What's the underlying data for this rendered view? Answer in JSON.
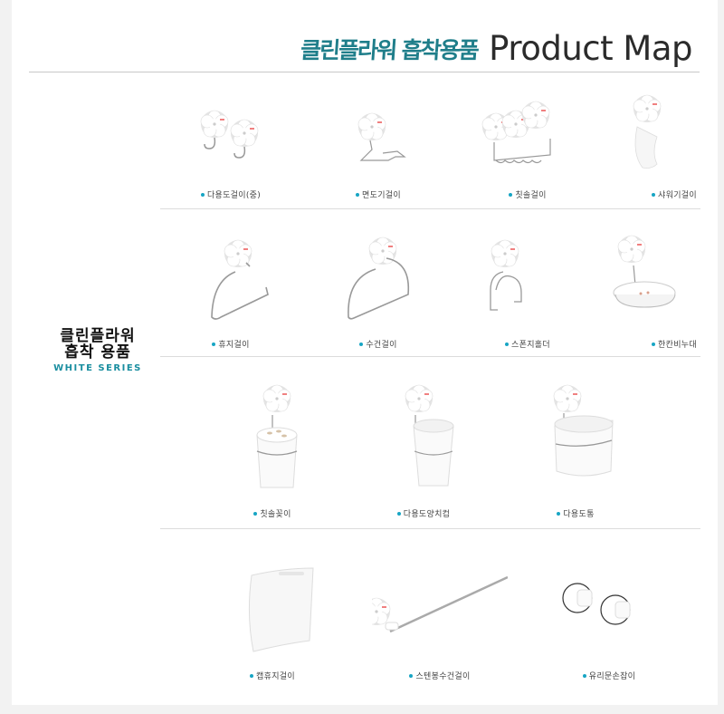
{
  "header": {
    "title_korean": "클린플라워 흡착용품",
    "title_english": "Product Map"
  },
  "series": {
    "name_line1": "클린플라워",
    "name_line2": "흡착 용품",
    "subtitle": "WHITE SERIES"
  },
  "colors": {
    "accent": "#1f7e8a",
    "bullet": "#17a5c4",
    "subtitle": "#1a8ea0"
  },
  "rows": [
    {
      "items": [
        {
          "label": "다용도걸이(중)",
          "icon": "twin-flower-hooks"
        },
        {
          "label": "면도기걸이",
          "icon": "razor-holder"
        },
        {
          "label": "칫솔걸이",
          "icon": "toothbrush-rack"
        },
        {
          "label": "샤워기걸이",
          "icon": "shower-holder"
        }
      ]
    },
    {
      "items": [
        {
          "label": "휴지걸이",
          "icon": "tissue-holder"
        },
        {
          "label": "수건걸이",
          "icon": "towel-ring"
        },
        {
          "label": "스폰지홀더",
          "icon": "sponge-holder"
        },
        {
          "label": "한칸비누대",
          "icon": "soap-dish"
        }
      ]
    },
    {
      "items": [
        {
          "label": "칫솔꽂이",
          "icon": "toothbrush-cup"
        },
        {
          "label": "다용도양치컵",
          "icon": "rinse-cup"
        },
        {
          "label": "다용도통",
          "icon": "storage-bin"
        }
      ]
    },
    {
      "items": [
        {
          "label": "캡휴지걸이",
          "icon": "covered-tissue-holder"
        },
        {
          "label": "스텐봉수건걸이",
          "icon": "towel-bar"
        },
        {
          "label": "유리문손잡이",
          "icon": "glass-door-handle"
        }
      ]
    }
  ]
}
